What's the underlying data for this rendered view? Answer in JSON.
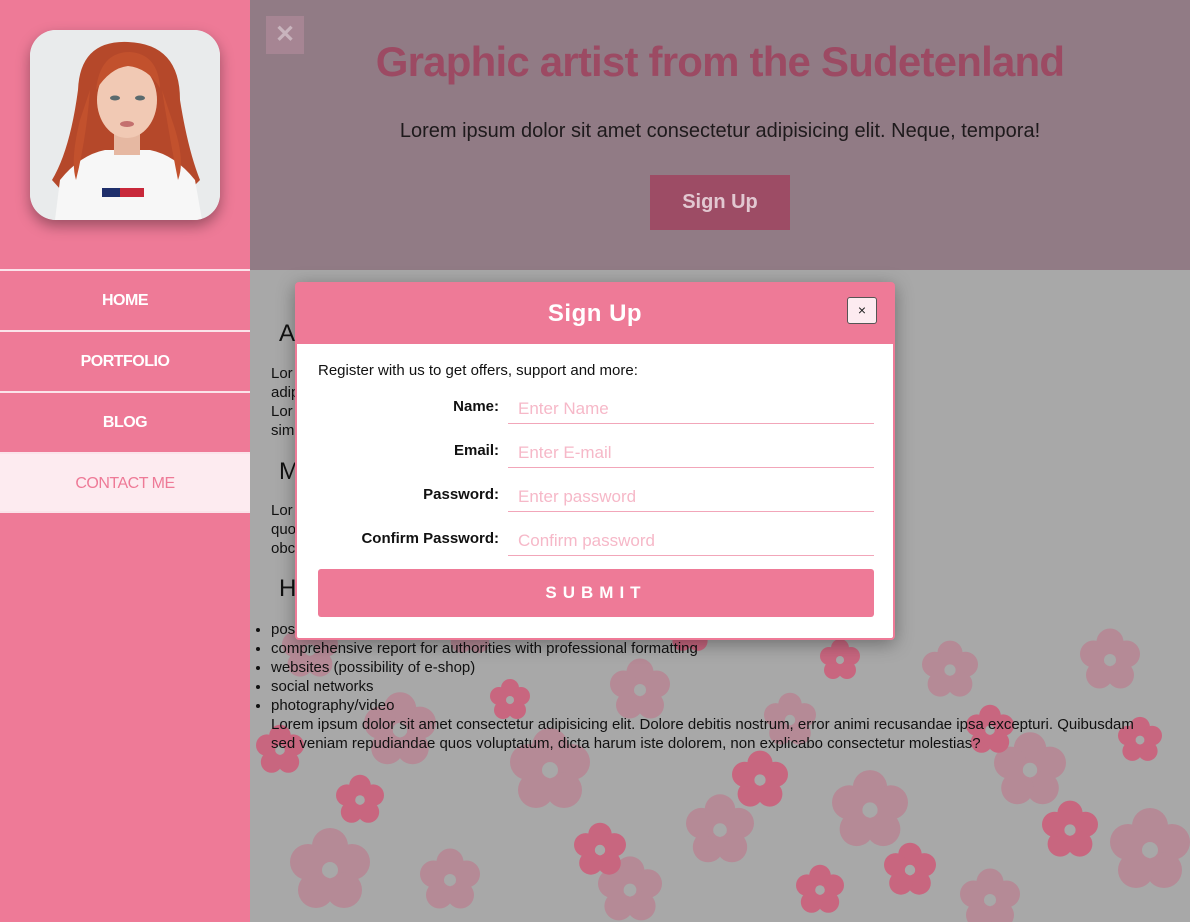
{
  "sidebar": {
    "nav": [
      {
        "label": "HOME"
      },
      {
        "label": "PORTFOLIO"
      },
      {
        "label": "BLOG"
      },
      {
        "label": "CONTACT ME",
        "active": true
      }
    ]
  },
  "hero": {
    "close_glyph": "✕",
    "title": "Graphic artist from the Sudetenland",
    "text": "Lorem ipsum dolor sit amet consectetur adipisicing elit. Neque, tempora!",
    "button": "Sign Up"
  },
  "content": {
    "headings": [
      "A",
      "M",
      "H"
    ],
    "para1_line1": "Lor                                                                                                                                           accusantium dolorem reprehenderit",
    "para1_line2": "adip                                                                                                                                           a facilis eos enim.",
    "para1_line3": "Lor                                                                                                                                           is odit nisi quidem velit voluptas hic",
    "para1_line4": "sim",
    "para2_line1": "Lor                                                                                                                                           ficiis temporibus aliquid nobis minima",
    "para2_line2": "quo                                                                                                                                           voluptatum neque minus quis culpa",
    "para2_line3": "obc",
    "list": [
      "pos",
      "comprehensive report for authorities with professional formatting",
      "websites (possibility of e-shop)",
      "social networks",
      "photography/video"
    ],
    "para3_line1": "Lorem ipsum dolor sit amet consectetur adipisicing elit. Dolore debitis nostrum, error animi recusandae ipsa excepturi. Quibusdam",
    "para3_line2": "sed veniam repudiandae quos voluptatum, dicta harum iste dolorem, non explicabo consectetur molestias?"
  },
  "modal": {
    "title": "Sign Up",
    "close_glyph": "×",
    "intro": "Register with us to get offers, support and more:",
    "fields": [
      {
        "label": "Name:",
        "placeholder": "Enter Name",
        "value": ""
      },
      {
        "label": "Email:",
        "placeholder": "Enter E-mail",
        "value": ""
      },
      {
        "label": "Password:",
        "placeholder": "Enter password",
        "value": ""
      },
      {
        "label": "Confirm Password:",
        "placeholder": "Confirm password",
        "value": ""
      }
    ],
    "submit": "SUBMIT"
  },
  "colors": {
    "accent": "#ee7a97",
    "accent_light": "#fdebf0",
    "hero_title": "#9c4a63"
  }
}
